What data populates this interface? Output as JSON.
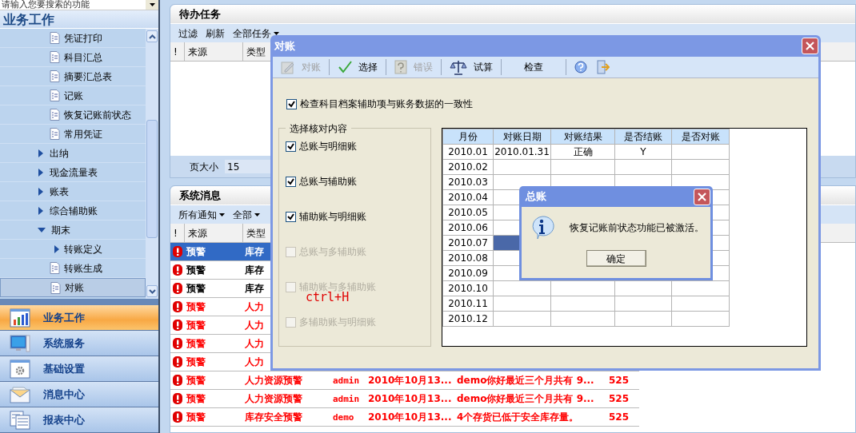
{
  "sidebar": {
    "search": {
      "placeholder": "请输入您要搜索的功能"
    },
    "title": "业务工作",
    "tree": {
      "scrolled_group_children": [
        {
          "label": "凭证打印",
          "kind": "doc",
          "selected": false
        },
        {
          "label": "科目汇总",
          "kind": "doc",
          "selected": false
        },
        {
          "label": "摘要汇总表",
          "kind": "doc",
          "selected": false
        },
        {
          "label": "记账",
          "kind": "doc",
          "selected": false
        },
        {
          "label": "恢复记账前状态",
          "kind": "doc",
          "selected": false
        },
        {
          "label": "常用凭证",
          "kind": "doc",
          "selected": false
        }
      ],
      "items": [
        {
          "label": "出纳",
          "kind": "folder",
          "expanded": false,
          "selected": false
        },
        {
          "label": "现金流量表",
          "kind": "folder",
          "expanded": false,
          "selected": false
        },
        {
          "label": "账表",
          "kind": "folder",
          "expanded": false,
          "selected": false
        },
        {
          "label": "综合辅助账",
          "kind": "folder",
          "expanded": false,
          "selected": false
        },
        {
          "label": "期末",
          "kind": "folder",
          "expanded": true,
          "selected": false,
          "children": [
            {
              "label": "转账定义",
              "kind": "folder",
              "expanded": false,
              "selected": false
            },
            {
              "label": "转账生成",
              "kind": "doc",
              "selected": false
            },
            {
              "label": "对账",
              "kind": "doc",
              "selected": true
            }
          ]
        }
      ]
    },
    "nav_buttons": [
      {
        "label": "业务工作",
        "selected": true
      },
      {
        "label": "系统服务",
        "selected": false
      },
      {
        "label": "基础设置",
        "selected": false
      },
      {
        "label": "消息中心",
        "selected": false
      },
      {
        "label": "报表中心",
        "selected": false
      }
    ]
  },
  "tasks_panel": {
    "title": "待办任务",
    "toolbar": [
      {
        "label": "过滤",
        "dropdown": false
      },
      {
        "label": "刷新",
        "dropdown": false
      },
      {
        "label": "全部任务",
        "dropdown": true
      }
    ],
    "flag_column": "!",
    "columns": [
      "来源",
      "类型"
    ],
    "page_size_label": "页大小",
    "page_size": "15"
  },
  "messages_panel": {
    "title": "系统消息",
    "toolbar": [
      {
        "label": "所有通知",
        "dropdown": true
      },
      {
        "label": "全部",
        "dropdown": true
      }
    ],
    "flag_column": "!",
    "columns": [
      "来源",
      "类型"
    ],
    "rows": [
      {
        "cells": [
          "预警",
          "库存"
        ],
        "selected": true
      },
      {
        "cells": [
          "预警",
          "库存"
        ],
        "selected": false,
        "color": "#000000"
      },
      {
        "cells": [
          "预警",
          "库存"
        ],
        "selected": false,
        "color": "#000000"
      },
      {
        "cells": [
          "预警",
          "人力"
        ],
        "selected": false,
        "color": "#ff0000"
      },
      {
        "cells": [
          "预警",
          "人力"
        ],
        "selected": false,
        "color": "#ff0000"
      },
      {
        "cells": [
          "预警",
          "人力"
        ],
        "selected": false,
        "color": "#ff0000"
      },
      {
        "cells": [
          "预警",
          "人力"
        ],
        "selected": false,
        "color": "#ff0000"
      },
      {
        "cells": [
          "预警",
          "人力资源预警",
          "admin",
          "2010年10月13...",
          "demo你好最近三个月共有 9...",
          "525"
        ],
        "selected": false,
        "color": "#ff0000"
      },
      {
        "cells": [
          "预警",
          "人力资源预警",
          "admin",
          "2010年10月13...",
          "demo你好最近三个月共有 9...",
          "525"
        ],
        "selected": false,
        "color": "#ff0000"
      },
      {
        "cells": [
          "预警",
          "库存安全预警",
          "demo",
          "2010年10月13...",
          "4个存货已低于安全库存量。",
          "525"
        ],
        "selected": false,
        "color": "#ff0000"
      }
    ]
  },
  "reconcile_dialog": {
    "title": "对账",
    "toolbar": [
      {
        "label": "对账",
        "disabled": true
      },
      {
        "label": "选择",
        "disabled": false
      },
      {
        "label": "错误",
        "disabled": true
      },
      {
        "label": "试算",
        "disabled": false
      },
      {
        "label": "检查",
        "disabled": false
      }
    ],
    "consistency_check": {
      "label": "检查科目档案辅助项与账务数据的一致性",
      "checked": true
    },
    "group": {
      "title": "选择核对内容",
      "options": [
        {
          "label": "总账与明细账",
          "checked": true,
          "disabled": false
        },
        {
          "label": "总账与辅助账",
          "checked": true,
          "disabled": false
        },
        {
          "label": "辅助账与明细账",
          "checked": true,
          "disabled": false
        },
        {
          "label": "总账与多辅助账",
          "checked": false,
          "disabled": true
        },
        {
          "label": "辅助账与多辅助账",
          "checked": false,
          "disabled": true
        },
        {
          "label": "多辅助账与明细账",
          "checked": false,
          "disabled": true
        }
      ]
    },
    "annotation": "ctrl+H",
    "grid": {
      "columns": [
        "月份",
        "对账日期",
        "对账结果",
        "是否结账",
        "是否对账"
      ],
      "rows": [
        {
          "month": "2010.01",
          "date": "2010.01.31",
          "result": "正确",
          "closed": "Y",
          "selected": false
        },
        {
          "month": "2010.02",
          "selected": false
        },
        {
          "month": "2010.03",
          "selected": false
        },
        {
          "month": "2010.04",
          "selected": false
        },
        {
          "month": "2010.05",
          "selected": false
        },
        {
          "month": "2010.06",
          "selected": false
        },
        {
          "month": "2010.07",
          "selected": true
        },
        {
          "month": "2010.08",
          "selected": false
        },
        {
          "month": "2010.09",
          "selected": false
        },
        {
          "month": "2010.10",
          "selected": false
        },
        {
          "month": "2010.11",
          "selected": false
        },
        {
          "month": "2010.12",
          "selected": false
        }
      ]
    }
  },
  "message_box": {
    "title": "总账",
    "message": "恢复记账前状态功能已被激活。",
    "button": "确定"
  }
}
